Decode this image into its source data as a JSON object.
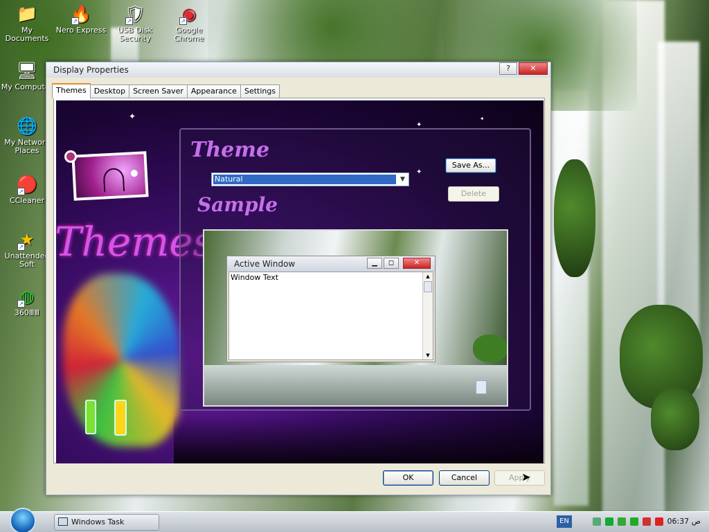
{
  "desktop": {
    "icons": [
      {
        "label": "My Documents",
        "glyph": "📁",
        "icon": "folder-icon",
        "shortcut": false
      },
      {
        "label": "Nero Express",
        "glyph": "🔥",
        "icon": "nero-icon",
        "shortcut": true
      },
      {
        "label": "USB Disk Security",
        "glyph": "🛡",
        "icon": "shield-icon",
        "shortcut": true
      },
      {
        "label": "Google Chrome",
        "glyph": "◉",
        "icon": "chrome-icon",
        "shortcut": true
      },
      {
        "label": "My Computer",
        "glyph": "🖥",
        "icon": "computer-icon",
        "shortcut": false
      },
      {
        "label": "My Network Places",
        "glyph": "🌐",
        "icon": "network-icon",
        "shortcut": false
      },
      {
        "label": "CCleaner",
        "glyph": "🔴",
        "icon": "ccleaner-icon",
        "shortcut": true
      },
      {
        "label": "Unattended Soft",
        "glyph": "★",
        "icon": "star-icon",
        "shortcut": true
      },
      {
        "label": "360ⅢⅢ",
        "glyph": "◍",
        "icon": "360-icon",
        "shortcut": true
      }
    ]
  },
  "dialog": {
    "title": "Display Properties",
    "help_label": "?",
    "close_label": "✕",
    "tabs": [
      "Themes",
      "Desktop",
      "Screen Saver",
      "Appearance",
      "Settings"
    ],
    "active_tab": "Themes",
    "art": {
      "big_text": "Themes",
      "theme_heading": "Theme",
      "sample_heading": "Sample"
    },
    "theme_select": {
      "value": "Natural"
    },
    "save_as_label": "Save As...",
    "delete_label": "Delete",
    "sample": {
      "window_title": "Active Window",
      "window_text": "Window Text"
    },
    "ok_label": "OK",
    "cancel_label": "Cancel",
    "apply_label": "Apply"
  },
  "taskbar": {
    "task_label": "Windows Task Manager",
    "language": "EN",
    "clock": "06:37 ص"
  }
}
